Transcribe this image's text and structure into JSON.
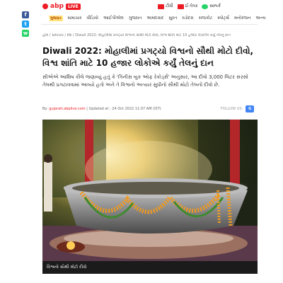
{
  "header": {
    "brand": "abp",
    "live": "LIVE",
    "links": [
      "ટીવી",
      "ઈ-પેપર",
      "સમ્પર્ક"
    ]
  },
  "nav": {
    "brand_chip": "ગુજરાત",
    "items": [
      "સમાચાર",
      "વીડિયો",
      "આઈપીએલ",
      "ગુજરાત",
      "અમદાવાદ",
      "સુરત",
      "વડોદરા",
      "રાજકોટ",
      "સ્પોર્ટ્સ",
      "મનોરંજન",
      "અન્ય"
    ]
  },
  "social": {
    "facebook": "f",
    "twitter": "t",
    "whatsapp": "w"
  },
  "breadcrumb": "હોમ / સમાચાર / દેશ / Diwali 2022: મોહાલીમાં પ્રગટ્યો વિશ્વનો સૌથી મોટો દીવો, વિશ્વ શાંતિ માટે 10 હજાર લોકોએ કર્યું તેલનું દાન",
  "article": {
    "headline": "Diwali 2022: મોહાલીમાં પ્રગટ્યો વિશ્વનો સૌથી મોટો દીવો, વિશ્વ શાંતિ માટે 10 હજાર લોકોએ કર્યું તેલનું દાન",
    "summary": "સીએએ આશિષ કૌલે જણાવ્યું હતું કે 'ગિનીસ બુક ઓફ રેકોર્ડ્સ' અનુસાર, આ દીવો 3,000 લિટર સરસોં તેલથી પ્રગટાવવામાં આવ્યો હતો અને તે વિશ્વનો અત્યાર સુધીનો સૌથી મોટો તેલનો દીવો છે.",
    "byline_label": "By: ",
    "byline_source": "gujarati.abplive.com",
    "updated": " | Updated at : 24 Oct 2022 11:07 AM (IST)",
    "follow_label": "FOLLOW US:",
    "gnews": "G",
    "image_caption": "વિશ્વનો સૌથી મોટો દીવો"
  },
  "colors": {
    "brand_red": "#ed1c24",
    "facebook": "#3b5998",
    "twitter": "#1da1f2",
    "whatsapp": "#25d366"
  }
}
